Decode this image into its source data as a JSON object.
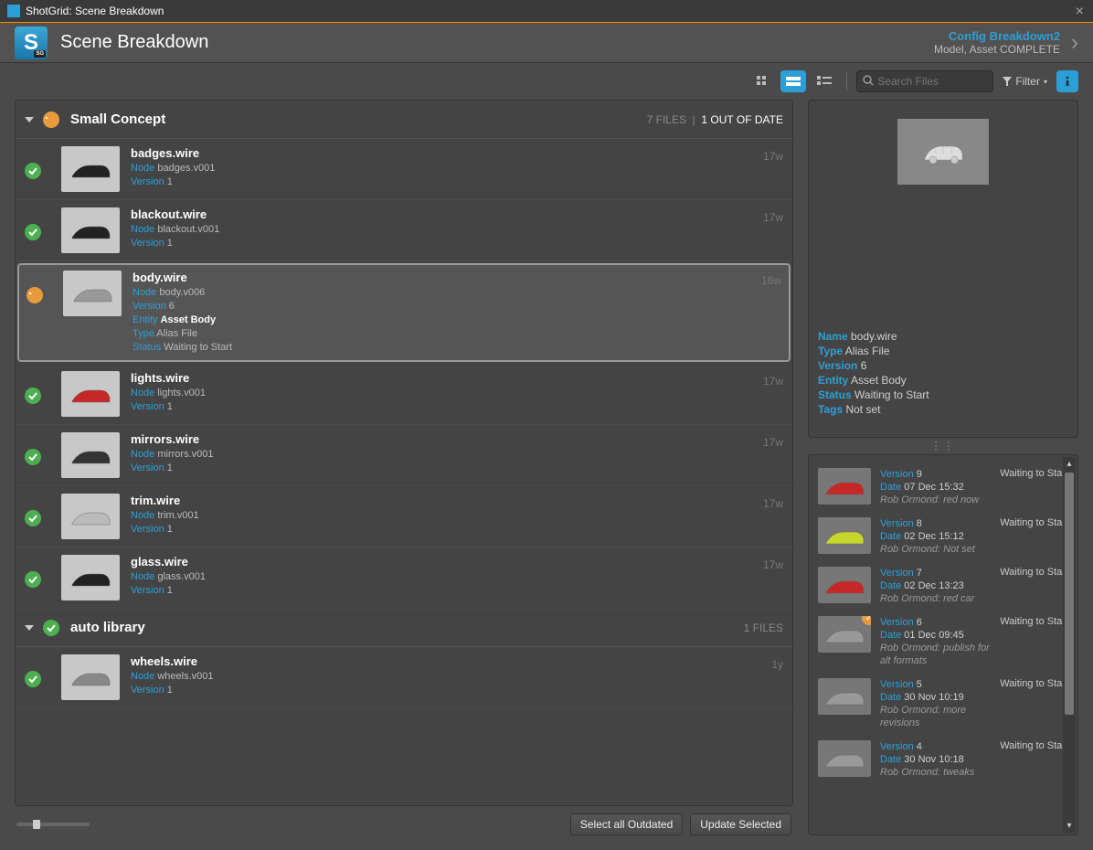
{
  "window": {
    "title": "ShotGrid: Scene Breakdown"
  },
  "header": {
    "app_icon_letter": "S",
    "app_icon_badge": "SG",
    "title": "Scene Breakdown",
    "config": "Config Breakdown2",
    "subtitle": "Model, Asset COMPLETE"
  },
  "toolbar": {
    "search_placeholder": "Search Files",
    "filter_label": "Filter"
  },
  "groups": [
    {
      "name": "Small Concept",
      "status": "update",
      "file_count": "7 FILES",
      "out_of_date": "1 OUT OF DATE",
      "files": [
        {
          "name": "badges.wire",
          "node": "badges.v001",
          "version": "1",
          "time": "17w",
          "status": "ok",
          "selected": false,
          "thumb": "badges"
        },
        {
          "name": "blackout.wire",
          "node": "blackout.v001",
          "version": "1",
          "time": "17w",
          "status": "ok",
          "selected": false,
          "thumb": "blackout"
        },
        {
          "name": "body.wire",
          "node": "body.v006",
          "version": "6",
          "entity": "Asset Body",
          "type": "Alias File",
          "file_status": "Waiting to Start",
          "time": "16w",
          "status": "update",
          "selected": true,
          "thumb": "body"
        },
        {
          "name": "lights.wire",
          "node": "lights.v001",
          "version": "1",
          "time": "17w",
          "status": "ok",
          "selected": false,
          "thumb": "lights"
        },
        {
          "name": "mirrors.wire",
          "node": "mirrors.v001",
          "version": "1",
          "time": "17w",
          "status": "ok",
          "selected": false,
          "thumb": "mirrors"
        },
        {
          "name": "trim.wire",
          "node": "trim.v001",
          "version": "1",
          "time": "17w",
          "status": "ok",
          "selected": false,
          "thumb": "trim"
        },
        {
          "name": "glass.wire",
          "node": "glass.v001",
          "version": "1",
          "time": "17w",
          "status": "ok",
          "selected": false,
          "thumb": "glass"
        }
      ]
    },
    {
      "name": "auto library",
      "status": "ok",
      "file_count": "1 FILES",
      "out_of_date": "",
      "files": [
        {
          "name": "wheels.wire",
          "node": "wheels.v001",
          "version": "1",
          "time": "1y",
          "status": "ok",
          "selected": false,
          "thumb": "wheels"
        }
      ]
    }
  ],
  "labels": {
    "node": "Node",
    "version": "Version",
    "entity": "Entity",
    "type": "Type",
    "status": "Status",
    "name": "Name",
    "tags": "Tags",
    "date": "Date"
  },
  "footer": {
    "select_outdated": "Select all Outdated",
    "update_selected": "Update Selected"
  },
  "preview": {
    "name": "body.wire",
    "type": "Alias File",
    "version": "6",
    "entity": "Asset Body",
    "status": "Waiting to Start",
    "tags": "Not set"
  },
  "versions": [
    {
      "version": "9",
      "date": "07 Dec 15:32",
      "comment": "Rob Ormond: red now",
      "status": "Waiting to Start",
      "color": "#c62828",
      "current": false
    },
    {
      "version": "8",
      "date": "02 Dec 15:12",
      "comment": "Rob Ormond: Not set",
      "status": "Waiting to Start",
      "color": "#c6d62a",
      "current": false
    },
    {
      "version": "7",
      "date": "02 Dec 13:23",
      "comment": "Rob Ormond: red car",
      "status": "Waiting to Start",
      "color": "#c62828",
      "current": false
    },
    {
      "version": "6",
      "date": "01 Dec 09:45",
      "comment": "Rob Ormond: publish for alt formats",
      "status": "Waiting to Start",
      "color": "#999",
      "current": true
    },
    {
      "version": "5",
      "date": "30 Nov 10:19",
      "comment": "Rob Ormond: more revisions",
      "status": "Waiting to Start",
      "color": "#999",
      "current": false
    },
    {
      "version": "4",
      "date": "30 Nov 10:18",
      "comment": "Rob Ormond: tweaks",
      "status": "Waiting to Start",
      "color": "#999",
      "current": false
    }
  ],
  "thumbs": {
    "badges": "#222",
    "blackout": "#222",
    "body": "#999",
    "lights": "#c62828",
    "mirrors": "#333",
    "trim": "#bbb",
    "glass": "#222",
    "wheels": "#888"
  }
}
